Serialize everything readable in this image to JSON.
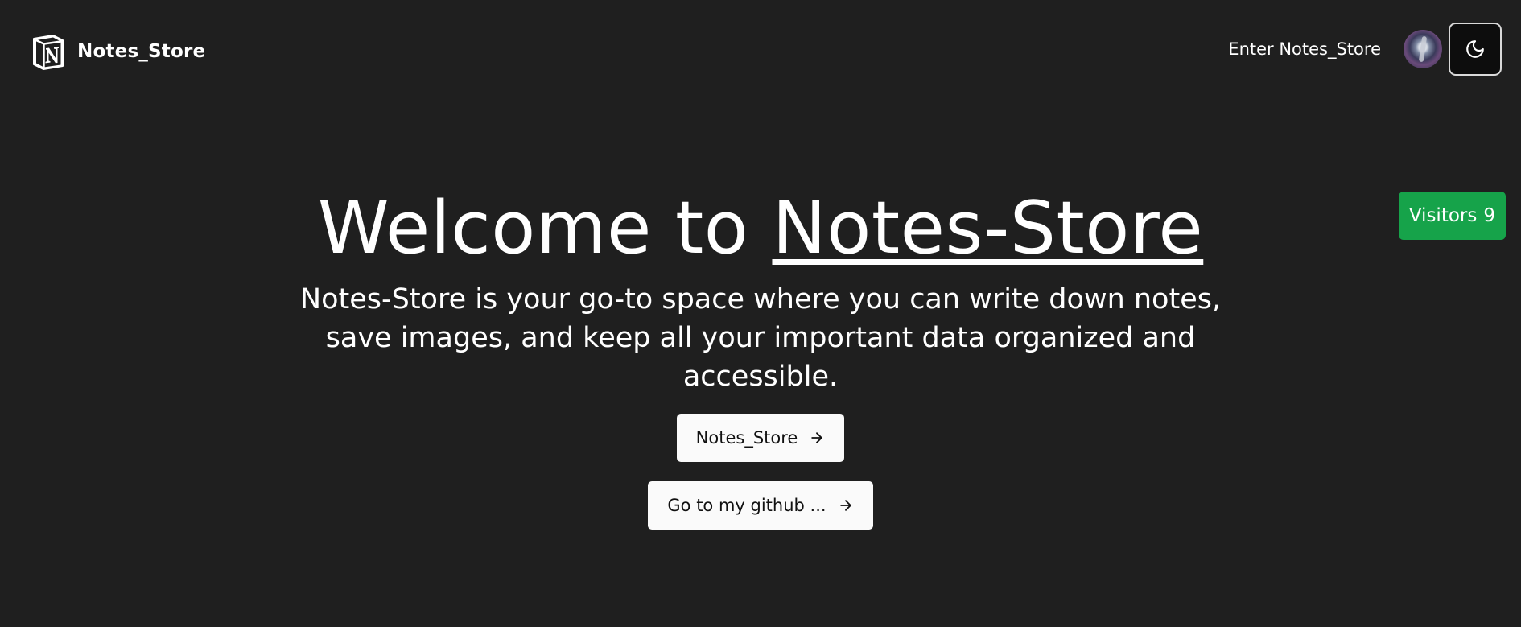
{
  "header": {
    "brand_name": "Notes_Store",
    "logo_icon": "notion-n-logo",
    "enter_link": "Enter Notes_Store",
    "avatar_icon": "user-avatar",
    "theme_toggle_icon": "moon-icon"
  },
  "visitors": {
    "label": "Visitors",
    "count": "9",
    "color": "#16a34a"
  },
  "hero": {
    "title_prefix": "Welcome to ",
    "title_brand": "Notes-Store",
    "subtitle": "Notes-Store is your go-to space where you can write down notes, save images, and keep all your important data organized and accessible.",
    "primary_button": "Notes_Store",
    "secondary_button": "Go to my github ...",
    "button_icon": "arrow-right-icon"
  },
  "colors": {
    "background": "#1f1f1f",
    "text": "#ffffff",
    "button_bg": "#fafafa",
    "toggle_bg": "#0d0d0d"
  }
}
